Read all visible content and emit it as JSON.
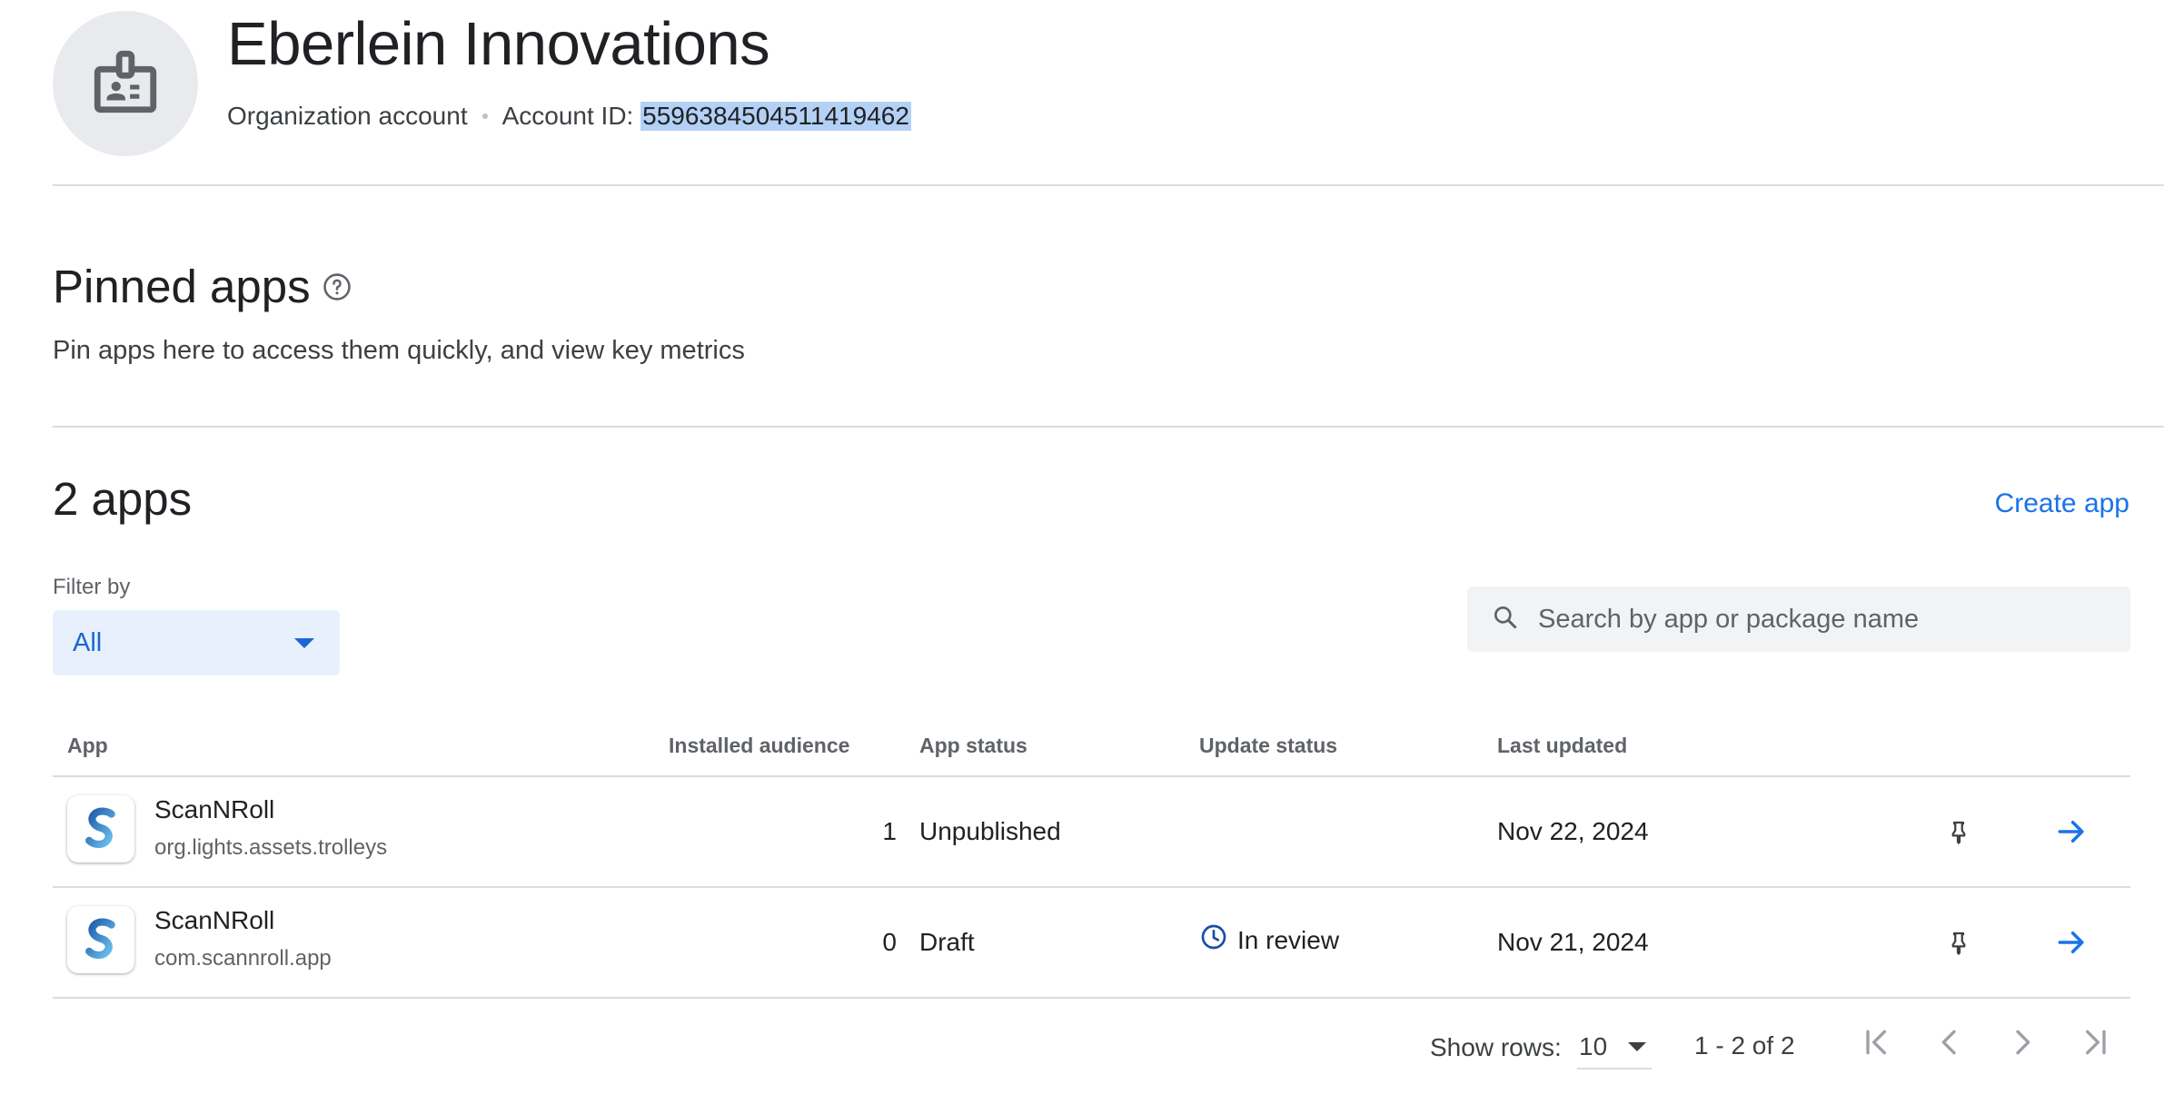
{
  "header": {
    "org_name": "Eberlein Innovations",
    "account_type": "Organization account",
    "account_id_label": "Account ID:",
    "account_id": "5596384504511419462"
  },
  "pinned": {
    "title": "Pinned apps",
    "description": "Pin apps here to access them quickly, and view key metrics"
  },
  "apps_section": {
    "title": "2 apps",
    "create_label": "Create app",
    "filter_label": "Filter by",
    "filter_value": "All",
    "search_placeholder": "Search by app or package name"
  },
  "table": {
    "columns": [
      "App",
      "Installed audience",
      "App status",
      "Update status",
      "Last updated"
    ],
    "rows": [
      {
        "name": "ScanNRoll",
        "package": "org.lights.assets.trolleys",
        "installed_audience": "1",
        "app_status": "Unpublished",
        "update_status": "",
        "last_updated": "Nov 22, 2024"
      },
      {
        "name": "ScanNRoll",
        "package": "com.scannroll.app",
        "installed_audience": "0",
        "app_status": "Draft",
        "update_status": "In review",
        "last_updated": "Nov 21, 2024"
      }
    ]
  },
  "pagination": {
    "show_rows_label": "Show rows:",
    "rows_per_page": "10",
    "range": "1 - 2 of 2"
  },
  "colors": {
    "accent": "#1a73e8",
    "selection_highlight": "#b3d1f5",
    "filter_bg": "#e8f0fe"
  },
  "icons": [
    "badge-icon",
    "help-icon",
    "search-icon",
    "clock-icon",
    "pin-icon",
    "arrow-right-icon",
    "first-page-icon",
    "prev-page-icon",
    "next-page-icon",
    "last-page-icon"
  ]
}
